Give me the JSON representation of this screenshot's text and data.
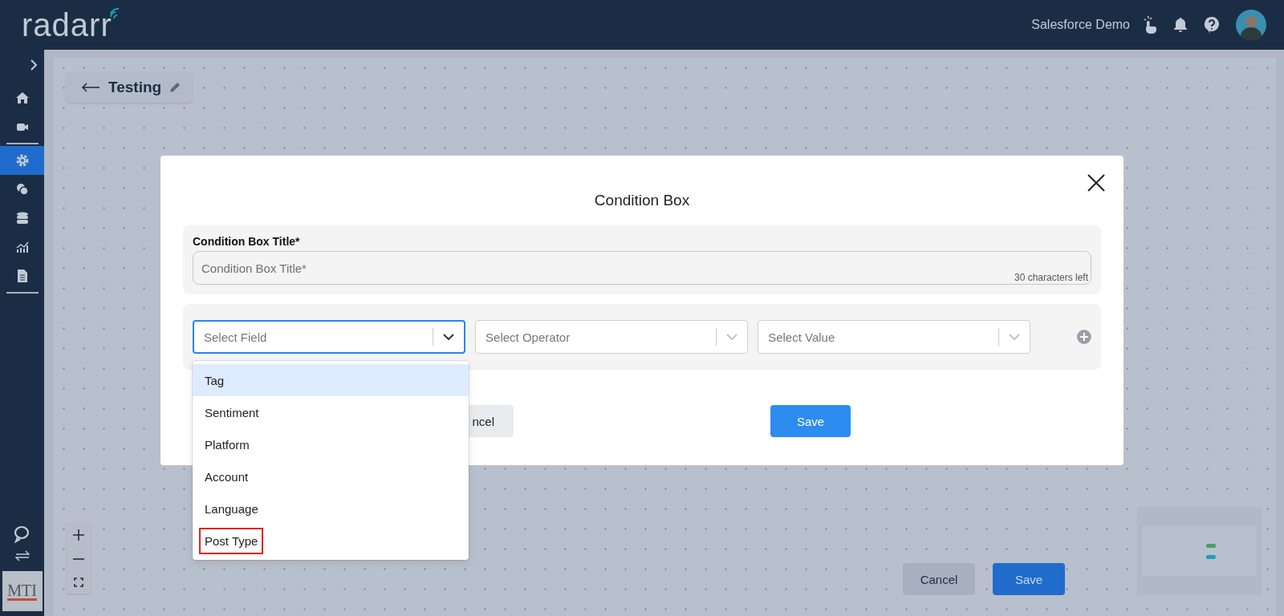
{
  "header": {
    "logo": "radarr",
    "account": "Salesforce Demo"
  },
  "sidebar": {
    "items": [
      {
        "selected": false
      },
      {
        "selected": false
      },
      {
        "selected": true
      },
      {
        "selected": false
      },
      {
        "selected": false
      },
      {
        "selected": false
      },
      {
        "selected": false
      }
    ],
    "org_logo": "MTI"
  },
  "canvas": {
    "flow_title": "Testing",
    "buttons": [
      {
        "label": "Cancel",
        "kind": "secondary"
      },
      {
        "label": "Save",
        "kind": "primary"
      }
    ]
  },
  "modal": {
    "title": "Condition Box",
    "title_field": {
      "label": "Condition Box Title*",
      "placeholder": "Condition Box Title*",
      "counter": "30 characters left"
    },
    "selects": [
      {
        "placeholder": "Select Field",
        "focused": true
      },
      {
        "placeholder": "Select Operator",
        "focused": false
      },
      {
        "placeholder": "Select Value",
        "focused": false
      }
    ],
    "dropdown": {
      "options": [
        {
          "label": "Tag",
          "selected": true,
          "outlined": false
        },
        {
          "label": "Sentiment",
          "selected": false,
          "outlined": false
        },
        {
          "label": "Platform",
          "selected": false,
          "outlined": false
        },
        {
          "label": "Account",
          "selected": false,
          "outlined": false
        },
        {
          "label": "Language",
          "selected": false,
          "outlined": false
        },
        {
          "label": "Post Type",
          "selected": false,
          "outlined": true
        }
      ]
    },
    "buttons": [
      {
        "label": "ncel",
        "kind": "secondary"
      },
      {
        "label": "Save",
        "kind": "primary"
      }
    ]
  }
}
